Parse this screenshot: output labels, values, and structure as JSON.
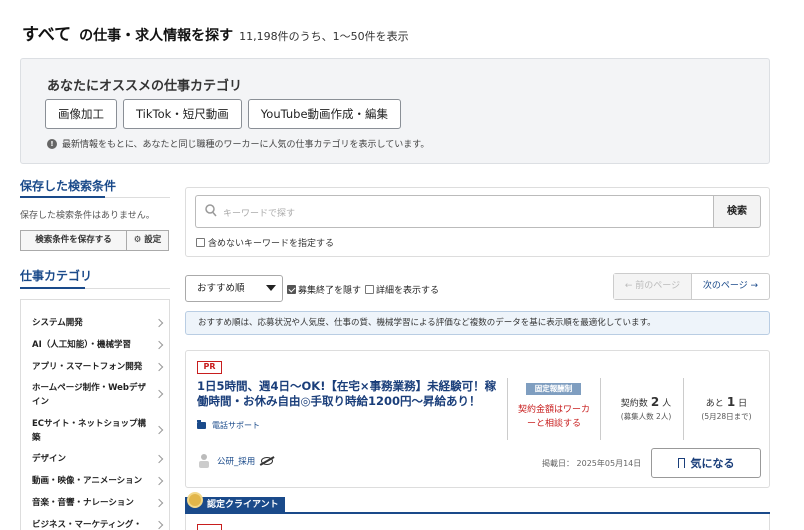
{
  "header": {
    "all": "すべて",
    "title": "の仕事・求人情報を探す",
    "count": "11,198件のうち、1〜50件を表示"
  },
  "recommend": {
    "title": "あなたにオススメの仕事カテゴリ",
    "tags": [
      "画像加工",
      "TikTok・短尺動画",
      "YouTube動画作成・編集"
    ],
    "note": "最新情報をもとに、あなたと同じ職種のワーカーに人気の仕事カテゴリを表示しています。",
    "note_icon": "info-icon"
  },
  "sidebar": {
    "saved_title": "保存した検索条件",
    "saved_empty": "保存した検索条件はありません。",
    "save_button": "検索条件を保存する",
    "settings_button": "設定",
    "category_title": "仕事カテゴリ",
    "categories": [
      "システム開発",
      "AI（人工知能）・機械学習",
      "アプリ・スマートフォン開発",
      "ホームページ制作・Webデザイン",
      "ECサイト・ネットショップ構築",
      "デザイン",
      "動画・映像・アニメーション",
      "音楽・音響・ナレーション",
      "ビジネス・マーケティング・企"
    ],
    "accent_color": "#1a4a8a"
  },
  "search": {
    "placeholder": "キーワードで探す",
    "button": "検索",
    "exclude_label": "含めないキーワードを指定する"
  },
  "controls": {
    "sort_value": "おすすめ順",
    "hide_closed": "募集終了を隠す",
    "show_details": "詳細を表示する",
    "prev_page": "← 前のページ",
    "next_page": "次のページ →"
  },
  "sort_note": "おすすめ順は、応募状況や人気度、仕事の質、機械学習による評価など複数のデータを基に表示順を最適化しています。",
  "job": {
    "pr": "PR",
    "title": "1日5時間、週4日〜OK!【在宅×事務業務】未経験可！稼働時間・お休み自由◎手取り時給1200円〜昇給あり！",
    "category": "電話サポート",
    "pay_type": "固定報酬制",
    "pay_text": "契約金額はワーカーと相談する",
    "contracts_label": "契約数",
    "contracts_value": "2",
    "contracts_unit": "人",
    "contracts_sub": "(募集人数 2人)",
    "remaining_label": "あと",
    "remaining_value": "1",
    "remaining_unit": "日",
    "remaining_sub": "(5月28日まで)",
    "client": "公研_採用",
    "posted": "掲載日： 2025年05月14日",
    "favorite": "気になる"
  },
  "certified": {
    "label": "認定クライアント"
  },
  "colors": {
    "brand": "#1a4a8a",
    "pr_red": "#c81e1e",
    "badge_blue": "#7f9ec0"
  }
}
